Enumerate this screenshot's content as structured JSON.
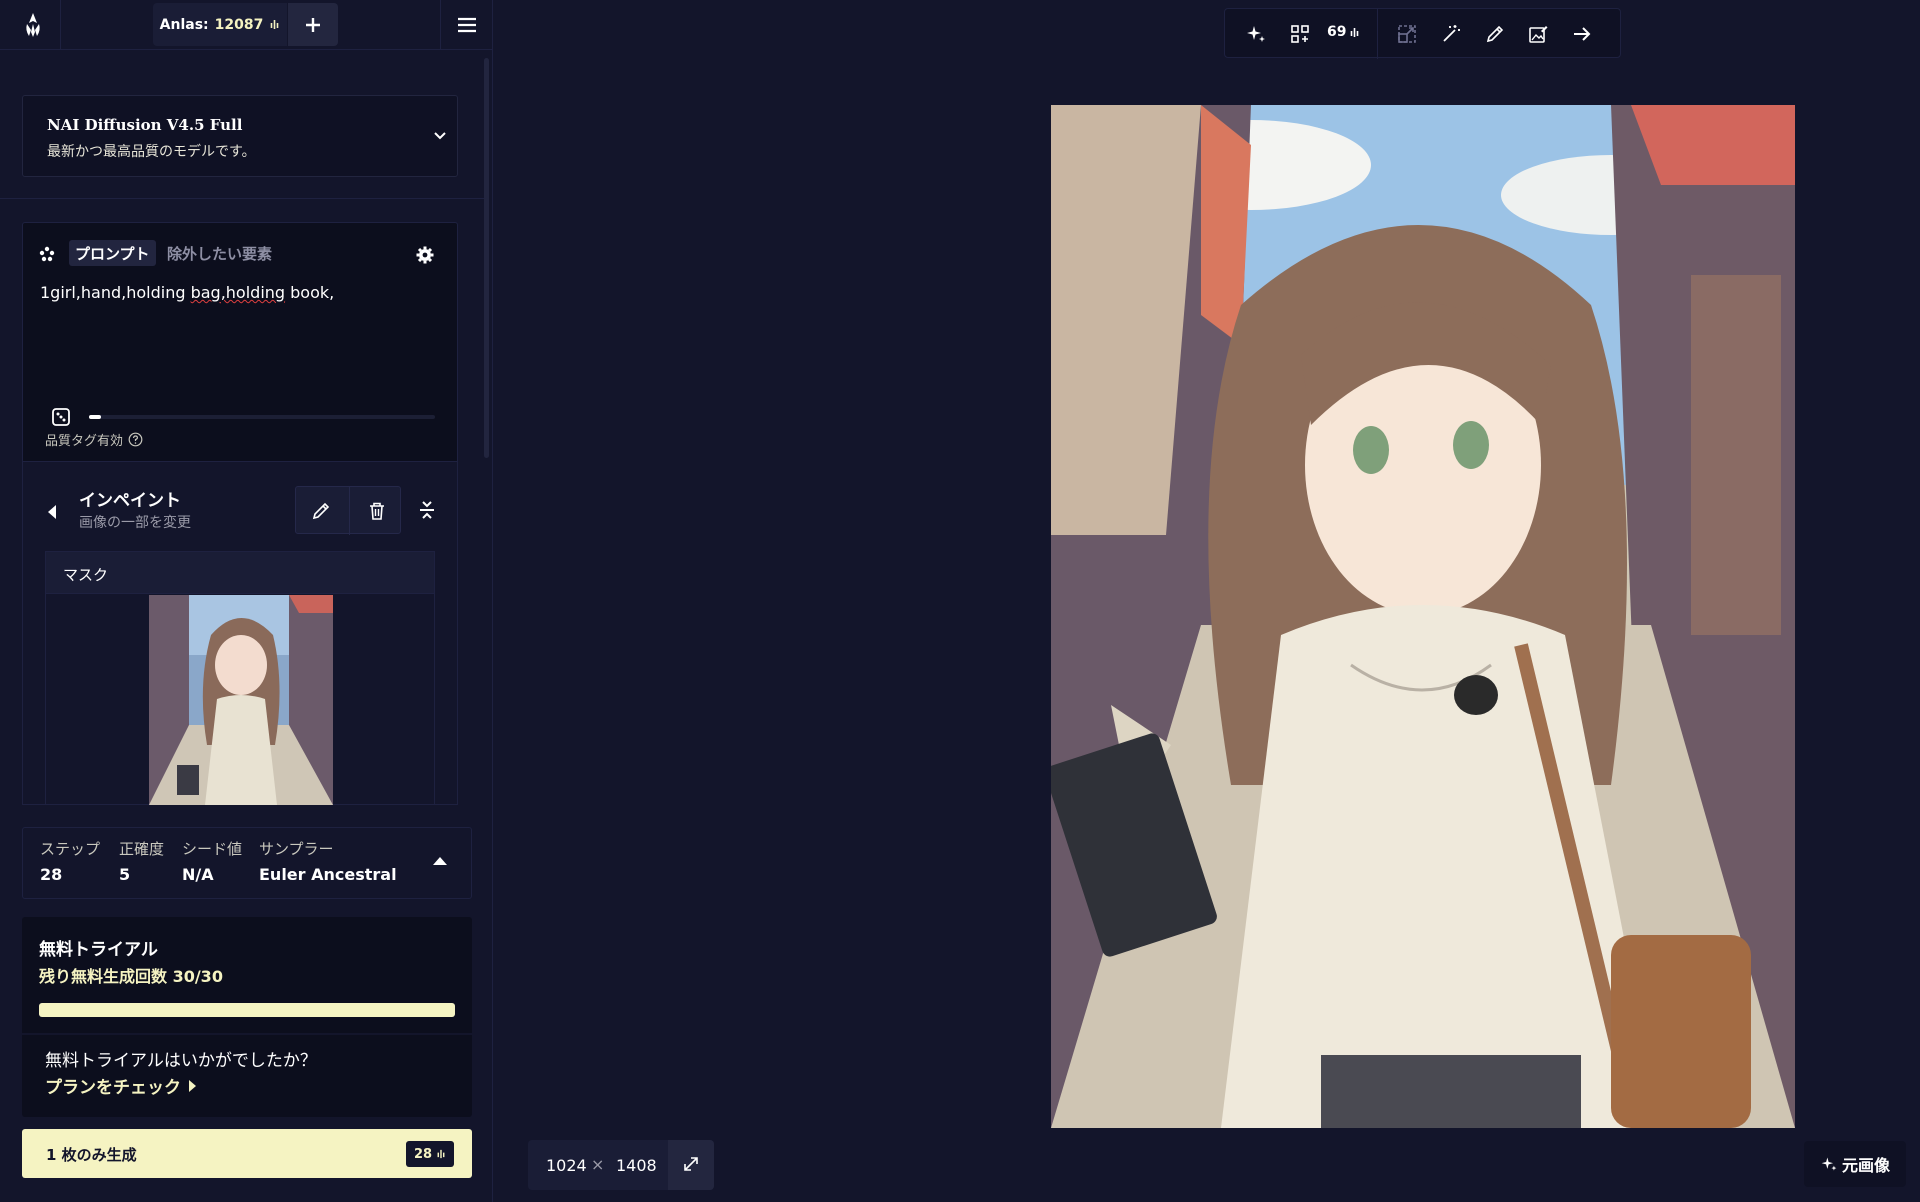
{
  "header": {
    "anlas_label": "Anlas:",
    "anlas_value": "12087"
  },
  "model": {
    "name": "NAI Diffusion V4.5 Full",
    "description": "最新かつ最高品質のモデルです。"
  },
  "prompt": {
    "tab_prompt": "プロンプト",
    "tab_negative": "除外したい要素",
    "text_before": "1girl,hand,holding ",
    "text_flagged": "bag,holding",
    "text_after": " book,",
    "token_usage": 0.035,
    "quality_tags_label": "品質タグ有効"
  },
  "inpaint": {
    "title": "インペイント",
    "subtitle": "画像の一部を変更",
    "mask_label": "マスク"
  },
  "params": {
    "steps": {
      "label": "ステップ",
      "value": "28"
    },
    "guidance": {
      "label": "正確度",
      "value": "5"
    },
    "seed": {
      "label": "シード値",
      "value": "N/A"
    },
    "sampler": {
      "label": "サンプラー",
      "value": "Euler Ancestral"
    }
  },
  "trial": {
    "title": "無料トライアル",
    "remaining": "残り無料生成回数 30/30",
    "progress": 1.0,
    "question": "無料トライアルはいかがでしたか？",
    "link": "プランをチェック"
  },
  "generate": {
    "label": "1 枚のみ生成",
    "cost": "28"
  },
  "toolbar": {
    "cost": "69"
  },
  "image": {
    "width": "1024",
    "times": "×",
    "height": "1408"
  },
  "original_button": "元画像",
  "colors": {
    "background": "#13152b",
    "panel": "#0c0e1d",
    "accent": "#f5f3c2"
  },
  "icons": [
    "logo-icon",
    "plus-icon",
    "menu-icon",
    "chevron-down-icon",
    "sparkle-icon",
    "gear-icon",
    "dice-icon",
    "help-icon",
    "back-arrow-icon",
    "pencil-icon",
    "trash-icon",
    "collapse-icon",
    "caret-up-icon",
    "caret-right-icon",
    "anlas-icon",
    "magic-icon",
    "enhance-icon",
    "upscale-icon",
    "wand-icon",
    "edit-image-icon",
    "arrow-right-icon",
    "expand-icon"
  ]
}
